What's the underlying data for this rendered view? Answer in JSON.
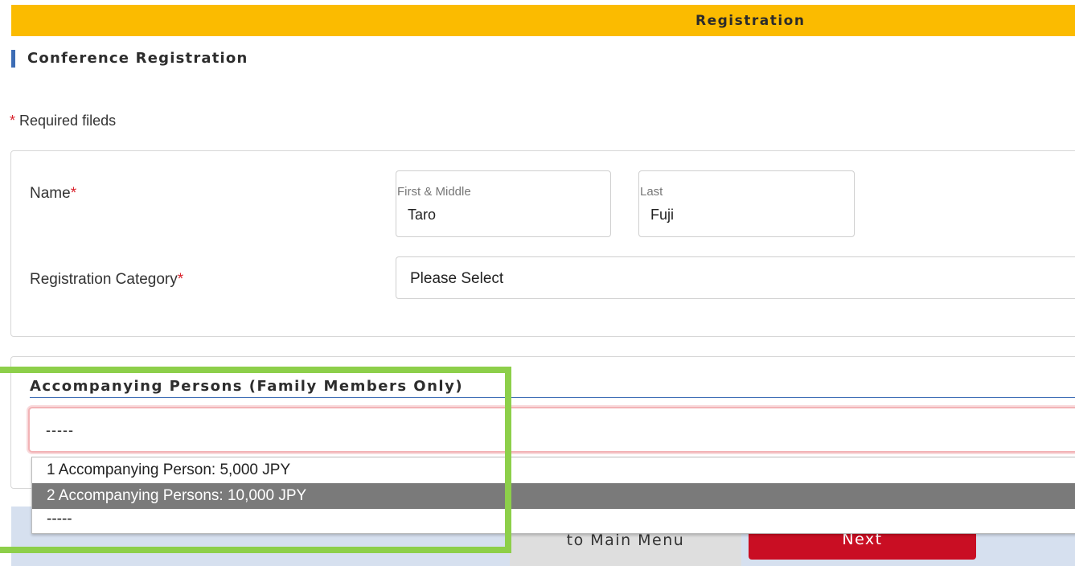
{
  "header": {
    "title": "Registration"
  },
  "section": {
    "title": "Conference Registration"
  },
  "required_note": {
    "star": "*",
    "text": " Required fileds"
  },
  "name_field": {
    "label": "Name",
    "star": "*",
    "first": {
      "sublabel": "First & Middle",
      "value": "Taro"
    },
    "last": {
      "sublabel": "Last",
      "value": "Fuji"
    }
  },
  "category_field": {
    "label": "Registration Category",
    "star": "*",
    "selected": "Please Select"
  },
  "accompanying": {
    "title": "Accompanying Persons (Family Members Only)",
    "selected": "-----",
    "options": [
      {
        "label": "1 Accompanying Person: 5,000 JPY",
        "selected": false
      },
      {
        "label": "2 Accompanying Persons: 10,000 JPY",
        "selected": true
      },
      {
        "label": "-----",
        "selected": false
      }
    ]
  },
  "footer": {
    "main_menu_label": "to Main Menu",
    "next_label": "Next"
  },
  "colors": {
    "topbar": "#fbbb00",
    "accent_blue": "#3d6db5",
    "required_star": "#d9232d",
    "next_button": "#c90e23",
    "highlight": "#8dcf4a",
    "selected_option": "#7a7a7a"
  }
}
